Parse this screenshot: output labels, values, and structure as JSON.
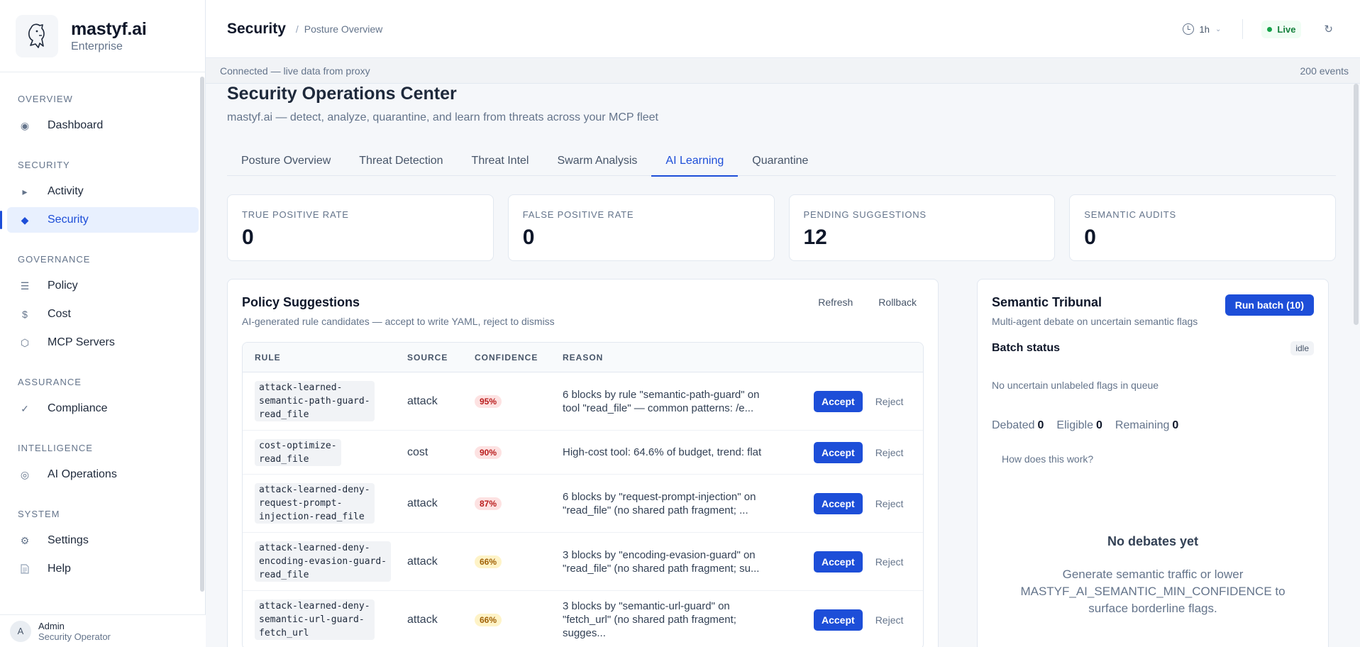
{
  "brand": {
    "name": "mastyf.ai",
    "edition": "Enterprise"
  },
  "sidebar": {
    "sections": [
      {
        "heading": "OVERVIEW",
        "items": [
          {
            "label": "Dashboard",
            "icon": "radio-dot-icon",
            "glyph": "◉"
          }
        ]
      },
      {
        "heading": "SECURITY",
        "items": [
          {
            "label": "Activity",
            "icon": "play-caret-icon",
            "glyph": "▸"
          },
          {
            "label": "Security",
            "icon": "diamond-icon",
            "glyph": "◆",
            "active": true
          }
        ]
      },
      {
        "heading": "GOVERNANCE",
        "items": [
          {
            "label": "Policy",
            "icon": "list-icon",
            "glyph": "☰"
          },
          {
            "label": "Cost",
            "icon": "dollar-icon",
            "glyph": "$"
          },
          {
            "label": "MCP Servers",
            "icon": "hexagon-icon",
            "glyph": "⬡"
          }
        ]
      },
      {
        "heading": "ASSURANCE",
        "items": [
          {
            "label": "Compliance",
            "icon": "check-icon",
            "glyph": "✓"
          }
        ]
      },
      {
        "heading": "INTELLIGENCE",
        "items": [
          {
            "label": "AI Operations",
            "icon": "target-icon",
            "glyph": "◎"
          }
        ]
      },
      {
        "heading": "SYSTEM",
        "items": [
          {
            "label": "Settings",
            "icon": "gear-icon",
            "glyph": "⚙"
          },
          {
            "label": "Help",
            "icon": "document-icon",
            "glyph": "📄"
          }
        ]
      }
    ]
  },
  "user": {
    "initial": "A",
    "name": "Admin",
    "role": "Security Operator"
  },
  "header": {
    "title": "Security",
    "separator": "/",
    "breadcrumb": "Posture Overview",
    "time_range": "1h",
    "live_label": "Live"
  },
  "status_strip": {
    "connection": "Connected — live data from proxy",
    "events": "200 events"
  },
  "page": {
    "title": "Security Operations Center",
    "subtitle": "mastyf.ai — detect, analyze, quarantine, and learn from threats across your MCP fleet"
  },
  "tabs": [
    {
      "label": "Posture Overview"
    },
    {
      "label": "Threat Detection"
    },
    {
      "label": "Threat Intel"
    },
    {
      "label": "Swarm Analysis"
    },
    {
      "label": "AI Learning",
      "active": true
    },
    {
      "label": "Quarantine"
    }
  ],
  "stats": [
    {
      "label": "TRUE POSITIVE RATE",
      "value": "0"
    },
    {
      "label": "FALSE POSITIVE RATE",
      "value": "0"
    },
    {
      "label": "PENDING SUGGESTIONS",
      "value": "12"
    },
    {
      "label": "SEMANTIC AUDITS",
      "value": "0"
    }
  ],
  "policy_suggestions": {
    "title": "Policy Suggestions",
    "subtitle": "AI-generated rule candidates — accept to write YAML, reject to dismiss",
    "refresh_label": "Refresh",
    "rollback_label": "Rollback",
    "columns": [
      "RULE",
      "SOURCE",
      "CONFIDENCE",
      "REASON"
    ],
    "accept_label": "Accept",
    "reject_label": "Reject",
    "rows": [
      {
        "rule_lines": [
          "attack-learned-",
          "semantic-path-guard-",
          "read_file"
        ],
        "source": "attack",
        "confidence": "95%",
        "level": "high",
        "reason_lines": [
          "6 blocks by rule \"semantic-path-guard\" on",
          "tool \"read_file\" — common patterns: /e..."
        ]
      },
      {
        "rule_lines": [
          "cost-optimize-",
          "read_file"
        ],
        "source": "cost",
        "confidence": "90%",
        "level": "high",
        "reason_lines": [
          "High-cost tool: 64.6% of budget, trend: flat"
        ]
      },
      {
        "rule_lines": [
          "attack-learned-deny-",
          "request-prompt-",
          "injection-read_file"
        ],
        "source": "attack",
        "confidence": "87%",
        "level": "high",
        "reason_lines": [
          "6 blocks by \"request-prompt-injection\" on",
          "\"read_file\" (no shared path fragment; ..."
        ]
      },
      {
        "rule_lines": [
          "attack-learned-deny-",
          "encoding-evasion-guard-",
          "read_file"
        ],
        "source": "attack",
        "confidence": "66%",
        "level": "mid",
        "reason_lines": [
          "3 blocks by \"encoding-evasion-guard\" on",
          "\"read_file\" (no shared path fragment; su..."
        ]
      },
      {
        "rule_lines": [
          "attack-learned-deny-",
          "semantic-url-guard-",
          "fetch_url"
        ],
        "source": "attack",
        "confidence": "66%",
        "level": "mid",
        "reason_lines": [
          "3 blocks by \"semantic-url-guard\" on",
          "\"fetch_url\" (no shared path fragment;",
          "sugges..."
        ]
      }
    ]
  },
  "tribunal": {
    "title": "Semantic Tribunal",
    "subtitle": "Multi-agent debate on uncertain semantic flags",
    "run_label": "Run batch (10)",
    "batch_label": "Batch status",
    "batch_state": "idle",
    "queue_message": "No uncertain unlabeled flags in queue",
    "counters": [
      {
        "label": "Debated",
        "value": "0"
      },
      {
        "label": "Eligible",
        "value": "0"
      },
      {
        "label": "Remaining",
        "value": "0"
      }
    ],
    "how_label": "How does this work?",
    "empty_title": "No debates yet",
    "empty_message": "Generate semantic traffic or lower MASTYF_AI_SEMANTIC_MIN_CONFIDENCE to surface borderline flags."
  },
  "colors": {
    "accent": "#1d4ed8",
    "live": "#16a34a",
    "high_conf_bg": "#fde2e2",
    "mid_conf_bg": "#fef3c7"
  }
}
